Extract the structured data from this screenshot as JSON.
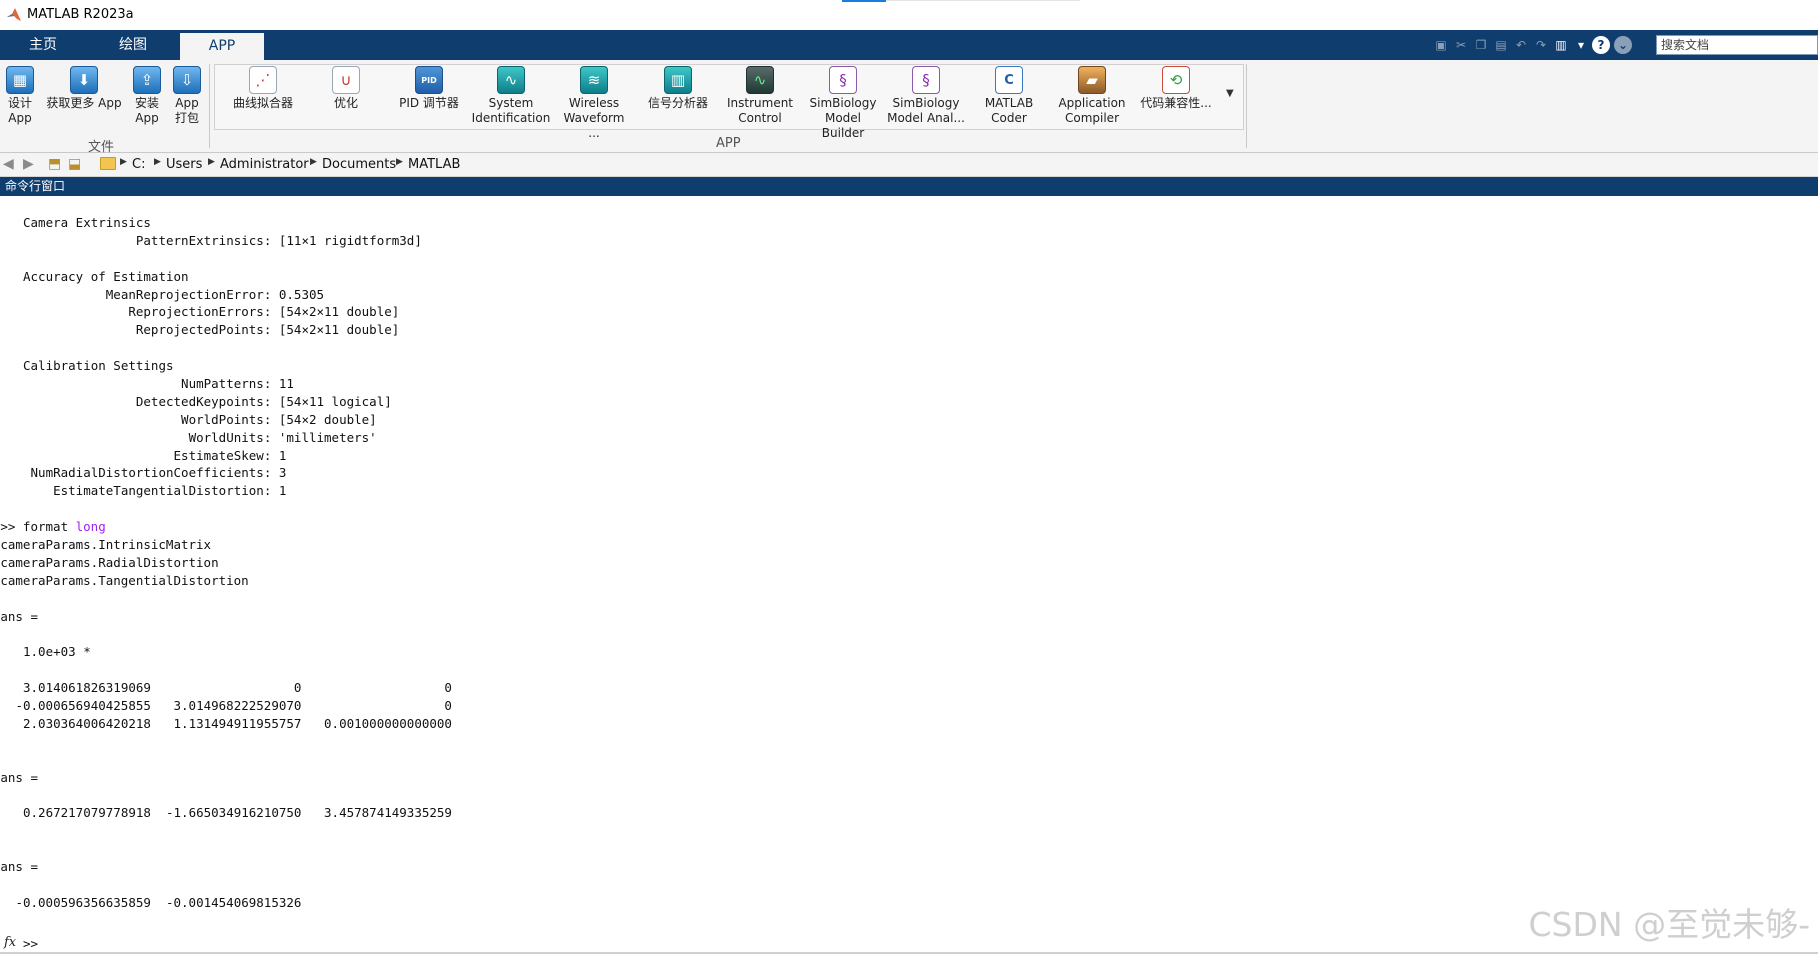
{
  "window": {
    "title": "MATLAB R2023a"
  },
  "tabs": [
    {
      "label": "主页"
    },
    {
      "label": "绘图"
    },
    {
      "label": "APP"
    }
  ],
  "search": {
    "placeholder": "搜索文档"
  },
  "ribbon": {
    "file_group": {
      "label": "文件",
      "buttons": [
        {
          "line1": "设计",
          "line2": "App",
          "icon": "design-app-icon"
        },
        {
          "line1": "获取更多 App",
          "line2": "",
          "icon": "get-more-apps-icon"
        },
        {
          "line1": "安装",
          "line2": "App",
          "icon": "install-app-icon"
        },
        {
          "line1": "App",
          "line2": "打包",
          "icon": "package-app-icon"
        }
      ]
    },
    "app_group": {
      "label": "APP",
      "buttons": [
        {
          "line1": "曲线拟合器",
          "line2": "",
          "icon": "curve-fitter-icon"
        },
        {
          "line1": "优化",
          "line2": "",
          "icon": "optimization-icon"
        },
        {
          "line1": "PID 调节器",
          "line2": "",
          "icon": "pid-tuner-icon",
          "icon_text": "PID"
        },
        {
          "line1": "System",
          "line2": "Identification",
          "icon": "system-identification-icon"
        },
        {
          "line1": "Wireless",
          "line2": "Waveform ...",
          "icon": "wireless-waveform-icon"
        },
        {
          "line1": "信号分析器",
          "line2": "",
          "icon": "signal-analyzer-icon"
        },
        {
          "line1": "Instrument",
          "line2": "Control",
          "icon": "instrument-control-icon"
        },
        {
          "line1": "SimBiology",
          "line2": "Model Builder",
          "icon": "simbiology-builder-icon"
        },
        {
          "line1": "SimBiology",
          "line2": "Model Anal...",
          "icon": "simbiology-analyzer-icon"
        },
        {
          "line1": "MATLAB",
          "line2": "Coder",
          "icon": "matlab-coder-icon",
          "icon_text": "C"
        },
        {
          "line1": "Application",
          "line2": "Compiler",
          "icon": "application-compiler-icon"
        },
        {
          "line1": "代码兼容性...",
          "line2": "",
          "icon": "code-compatibility-icon"
        }
      ]
    }
  },
  "address": {
    "crumbs": [
      "C:",
      "Users",
      "Administrator",
      "Documents",
      "MATLAB"
    ]
  },
  "panel": {
    "title": "命令行窗口"
  },
  "console": {
    "lines": [
      {
        "text": "Camera Extrinsics"
      },
      {
        "text": "               PatternExtrinsics: [11×1 rigidtform3d]"
      },
      {
        "text": ""
      },
      {
        "text": "Accuracy of Estimation"
      },
      {
        "text": "           MeanReprojectionError: 0.5305"
      },
      {
        "text": "              ReprojectionErrors: [54×2×11 double]"
      },
      {
        "text": "               ReprojectedPoints: [54×2×11 double]"
      },
      {
        "text": ""
      },
      {
        "text": "Calibration Settings"
      },
      {
        "text": "                     NumPatterns: 11"
      },
      {
        "text": "               DetectedKeypoints: [54×11 logical]"
      },
      {
        "text": "                     WorldPoints: [54×2 double]"
      },
      {
        "text": "                      WorldUnits: 'millimeters'"
      },
      {
        "text": "                    EstimateSkew: 1"
      },
      {
        "text": " NumRadialDistortionCoefficients: 3"
      },
      {
        "text": "    EstimateTangentialDistortion: 1"
      },
      {
        "text": ""
      },
      {
        "text": ">> format ",
        "kw": "long",
        "indent": -3
      },
      {
        "text": "cameraParams.IntrinsicMatrix",
        "indent": -3
      },
      {
        "text": "cameraParams.RadialDistortion",
        "indent": -3
      },
      {
        "text": "cameraParams.TangentialDistortion",
        "indent": -3
      },
      {
        "text": ""
      },
      {
        "text": "ans =",
        "indent": -3
      },
      {
        "text": ""
      },
      {
        "text": "1.0e+03 *"
      },
      {
        "text": ""
      },
      {
        "text": "3.014061826319069                   0                   0"
      },
      {
        "text": "-0.000656940425855   3.014968222529070                   0",
        "indent": -1
      },
      {
        "text": "2.030364006420218   1.131494911955757   0.001000000000000"
      },
      {
        "text": ""
      },
      {
        "text": ""
      },
      {
        "text": "ans =",
        "indent": -3
      },
      {
        "text": ""
      },
      {
        "text": "0.267217079778918  -1.665034916210750   3.457874149335259"
      },
      {
        "text": ""
      },
      {
        "text": ""
      },
      {
        "text": "ans =",
        "indent": -3
      },
      {
        "text": ""
      },
      {
        "text": "-0.000596356635859  -0.001454069815326",
        "indent": -1
      }
    ],
    "prompt": ">>",
    "fx_symbol": "fx"
  },
  "watermark": "CSDN @至觉未够-"
}
